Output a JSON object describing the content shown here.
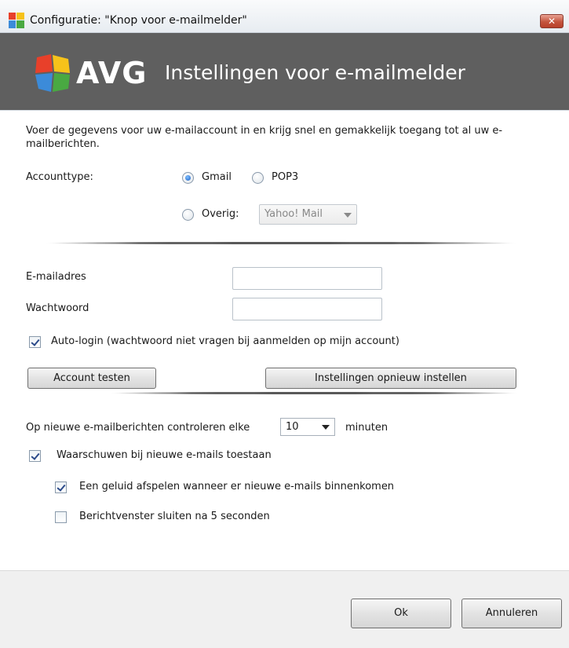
{
  "window": {
    "title": "Configuratie: \"Knop voor e-mailmelder\"",
    "close_label": "✕"
  },
  "banner": {
    "logo_text": "AVG",
    "title": "Instellingen voor e-mailmelder"
  },
  "form": {
    "description": "Voer de gegevens voor uw e-mailaccount in en krijg snel en gemakkelijk toegang tot al uw e-mailberichten.",
    "account_type_label": "Accounttype:",
    "radio_gmail": "Gmail",
    "radio_pop3": "POP3",
    "radio_other": "Overig:",
    "other_select_value": "Yahoo! Mail",
    "email_label": "E-mailadres",
    "email_value": "",
    "password_label": "Wachtwoord",
    "password_value": "",
    "autologin_label": "Auto-login (wachtwoord niet vragen bij aanmelden op mijn account)",
    "test_button": "Account testen",
    "reset_button": "Instellingen opnieuw instellen",
    "check_label_before": "Op nieuwe e-mailberichten controleren elke",
    "check_interval": "10",
    "check_label_after": "minuten",
    "warn_label": "Waarschuwen bij nieuwe e-mails toestaan",
    "sound_label": "Een geluid afspelen wanneer er nieuwe e-mails binnenkomen",
    "close_label": "Berichtvenster sluiten na 5 seconden"
  },
  "footer": {
    "ok_label": "Ok",
    "cancel_label": "Annuleren"
  },
  "state": {
    "selected_account_type": "Gmail",
    "autologin_checked": true,
    "warn_checked": true,
    "sound_checked": true,
    "close_checked": false
  },
  "colors": {
    "banner_bg": "#5f5f5f",
    "close_button": "#c4543d",
    "radio_selected": "#1d5fc4"
  }
}
